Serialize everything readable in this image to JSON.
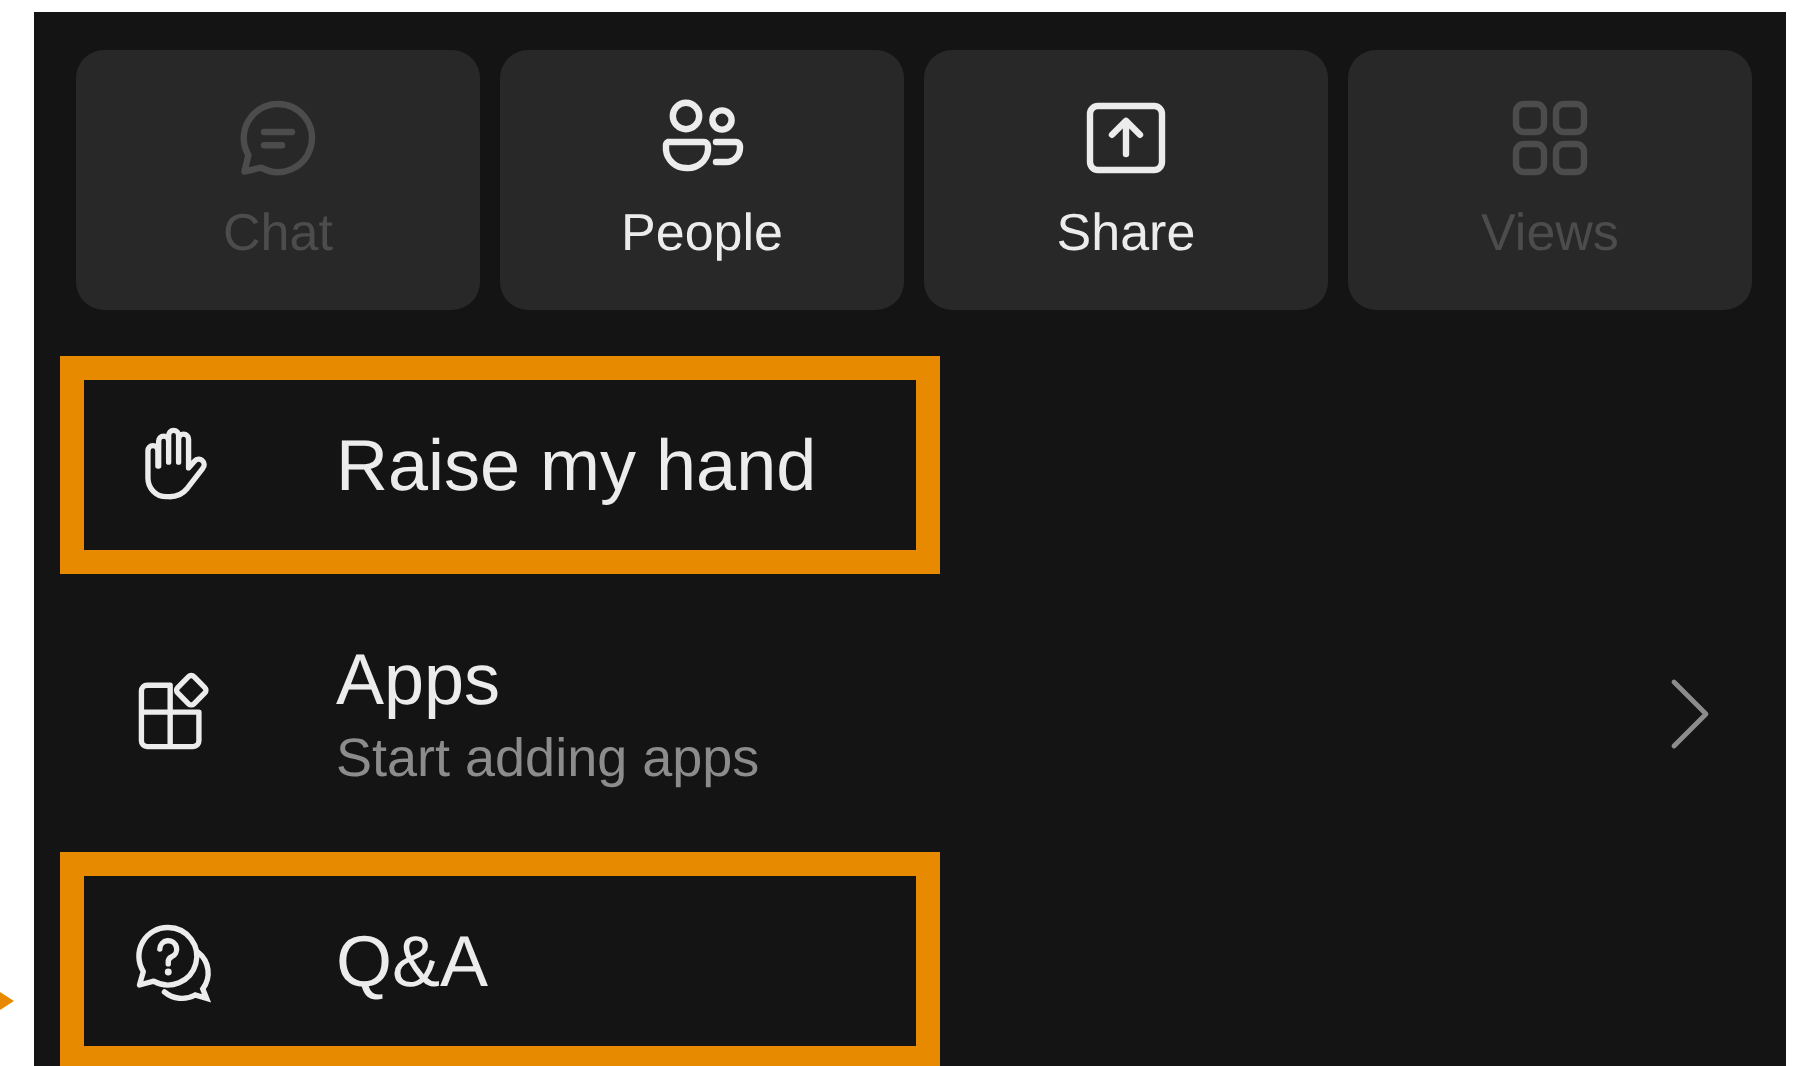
{
  "tiles": [
    {
      "label": "Chat",
      "disabled": true
    },
    {
      "label": "People",
      "disabled": false
    },
    {
      "label": "Share",
      "disabled": false
    },
    {
      "label": "Views",
      "disabled": true
    }
  ],
  "menu": [
    {
      "kind": "action",
      "title": "Raise my hand",
      "highlighted": true
    },
    {
      "kind": "link",
      "title": "Apps",
      "subtitle": "Start adding apps",
      "highlighted": false
    },
    {
      "kind": "action",
      "title": "Q&A",
      "highlighted": true
    }
  ]
}
